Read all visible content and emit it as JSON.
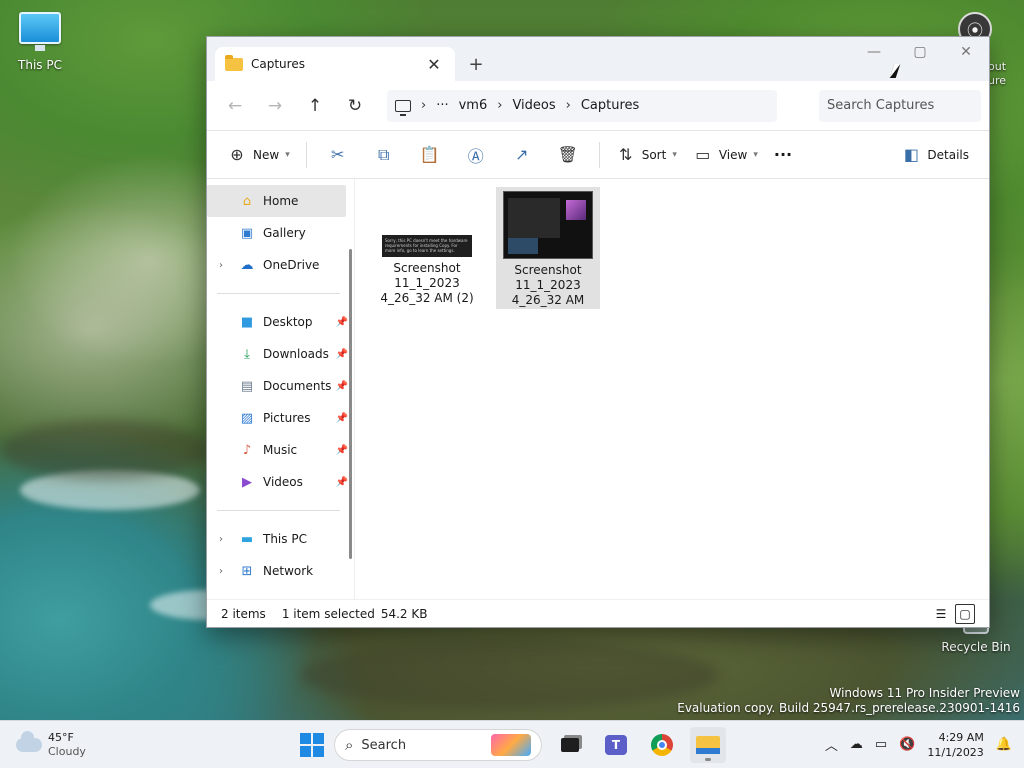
{
  "desktop": {
    "icons": [
      {
        "label": "This PC"
      },
      {
        "label": "Recycle Bin"
      }
    ],
    "partial_label": "out\nure",
    "watermark": {
      "line1": "Windows 11 Pro Insider Preview",
      "line2": "Evaluation copy. Build 25947.rs_prerelease.230901-1416"
    }
  },
  "window": {
    "tab_title": "Captures",
    "tab_close": "✕",
    "new_tab": "+",
    "controls": {
      "minimize": "—",
      "maximize": "▢",
      "close": "✕"
    },
    "nav": {
      "back": "←",
      "forward": "→",
      "up": "↑",
      "refresh": "↻"
    },
    "breadcrumb": [
      "···",
      "vm6",
      "Videos",
      "Captures"
    ],
    "search_placeholder": "Search Captures",
    "toolbar": {
      "new_label": "New",
      "sort_label": "Sort",
      "view_label": "View",
      "more_label": "···",
      "details_label": "Details"
    },
    "sidebar": {
      "top": [
        {
          "label": "Home",
          "active": true
        },
        {
          "label": "Gallery"
        },
        {
          "label": "OneDrive",
          "expandable": true
        }
      ],
      "quick_access": [
        {
          "label": "Desktop"
        },
        {
          "label": "Downloads"
        },
        {
          "label": "Documents"
        },
        {
          "label": "Pictures"
        },
        {
          "label": "Music"
        },
        {
          "label": "Videos"
        }
      ],
      "bottom": [
        {
          "label": "This PC"
        },
        {
          "label": "Network"
        }
      ]
    },
    "files": [
      {
        "name_lines": [
          "Screenshot",
          "11_1_2023",
          "4_26_32 AM (2)"
        ],
        "selected": false,
        "thumb_text": "Sorry, this PC doesn't meet the hardware requirements for installing Copy. For more info, go to learn the settings."
      },
      {
        "name_lines": [
          "Screenshot",
          "11_1_2023",
          "4_26_32 AM"
        ],
        "selected": true
      }
    ],
    "status": {
      "items": "2 items",
      "selection": "1 item selected",
      "size": "54.2 KB"
    }
  },
  "taskbar": {
    "weather": {
      "temp": "45°F",
      "condition": "Cloudy"
    },
    "search_label": "Search",
    "clock": {
      "time": "4:29 AM",
      "date": "11/1/2023"
    }
  },
  "colors": {
    "accent": "#1f8ae3",
    "folder": "#f5c242",
    "selection": "#e1e1e1"
  }
}
